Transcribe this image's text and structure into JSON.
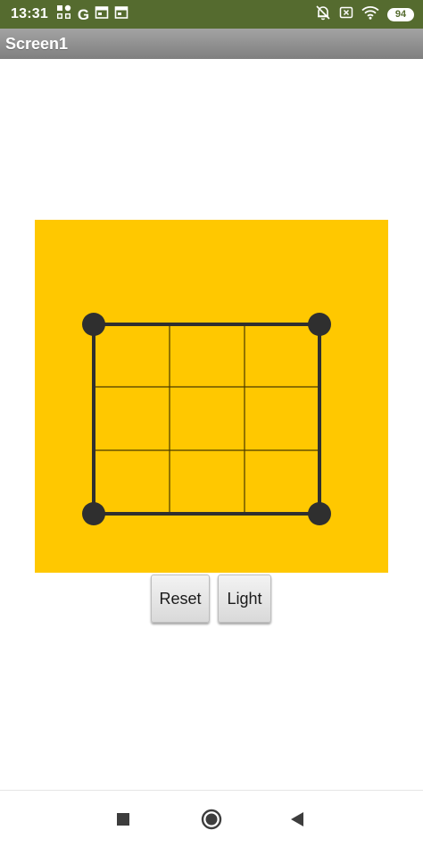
{
  "status_bar": {
    "time": "13:31",
    "google_letter": "G",
    "battery_level": "94",
    "icons": [
      "apps-grid-icon",
      "google-icon",
      "notification-card-icon",
      "notification-card-icon",
      "alarm-off-icon",
      "close-box-icon",
      "wifi-icon",
      "battery-icon"
    ]
  },
  "title_bar": {
    "title": "Screen1"
  },
  "game": {
    "board_color": "#ffc800",
    "line_color": "#2f2f2f",
    "grid": {
      "rows": 3,
      "cols": 3
    },
    "corner_dots": 4
  },
  "buttons": {
    "reset_label": "Reset",
    "light_label": "Light"
  },
  "navigation": {
    "icons": [
      "recents-icon",
      "home-icon",
      "back-icon"
    ]
  },
  "colors": {
    "status_bar": "#556b2f",
    "title_bar": "#8e8e8e",
    "board": "#ffc800"
  }
}
